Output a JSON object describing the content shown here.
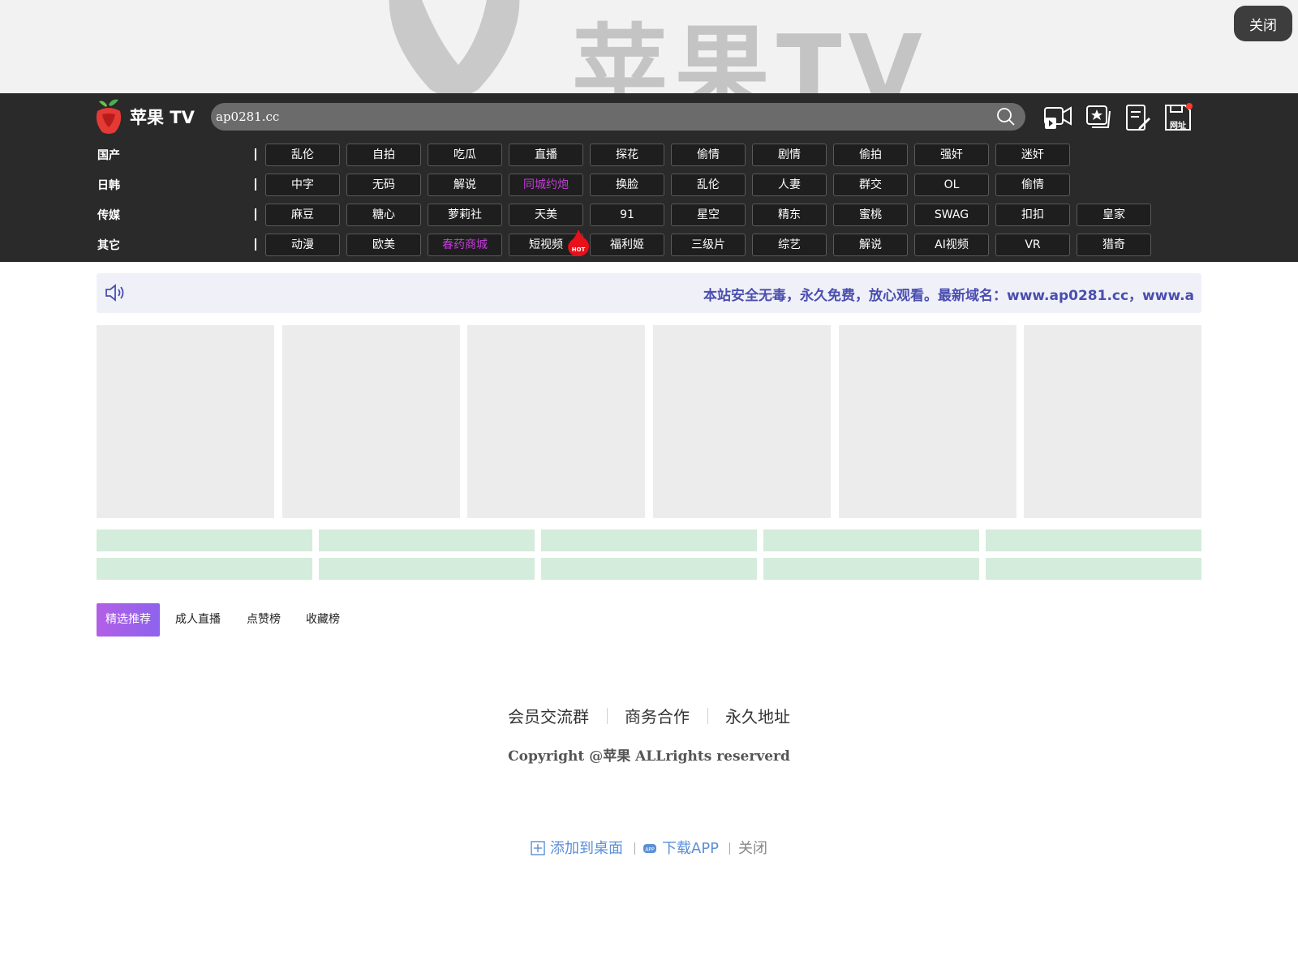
{
  "banner": {
    "brand_text": "苹果TV",
    "close_label": "关闭"
  },
  "header": {
    "logo_text": "苹果 TV",
    "search_value": "ap0281.cc",
    "icons": [
      "video-camera-icon",
      "star-cards-icon",
      "edit-note-icon",
      "save-url-icon"
    ],
    "save_badge_label": "网址"
  },
  "categories": [
    {
      "label": "国产",
      "tags": [
        "乱伦",
        "自拍",
        "吃瓜",
        "直播",
        "探花",
        "偷情",
        "剧情",
        "偷拍",
        "强奸",
        "迷奸"
      ]
    },
    {
      "label": "日韩",
      "tags": [
        "中字",
        "无码",
        "解说",
        "同城约炮",
        "换脸",
        "乱伦",
        "人妻",
        "群交",
        "OL",
        "偷情"
      ]
    },
    {
      "label": "传媒",
      "tags": [
        "麻豆",
        "糖心",
        "萝莉社",
        "天美",
        "91",
        "星空",
        "精东",
        "蜜桃",
        "SWAG",
        "扣扣",
        "皇家"
      ]
    },
    {
      "label": "其它",
      "tags": [
        "动漫",
        "欧美",
        "春药商城",
        "短视频",
        "福利姬",
        "三级片",
        "综艺",
        "解说",
        "AI视频",
        "VR",
        "猎奇"
      ]
    }
  ],
  "highlight_color": "#c23dd8",
  "hot_badge": "HOT",
  "notice": {
    "text": "本站安全无毒，永久免费，放心观看。最新域名：www.ap0281.cc，www.a"
  },
  "tabs": [
    "精选推荐",
    "成人直播",
    "点赞榜",
    "收藏榜"
  ],
  "footer": {
    "links": [
      "会员交流群",
      "商务合作",
      "永久地址"
    ],
    "copyright": "Copyright @苹果 ALLrights reserverd"
  },
  "bottom_bar": {
    "add_desktop": "添加到桌面",
    "download_app": "下载APP",
    "close": "关闭"
  }
}
